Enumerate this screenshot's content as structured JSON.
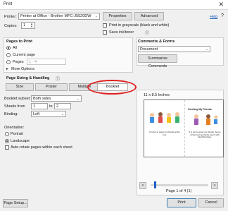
{
  "window": {
    "title": "Print"
  },
  "printer": {
    "label": "Printer:",
    "value": "Printer at Office - Brother MFC-J5520DW",
    "properties_label": "Properties",
    "advanced_label": "Advanced",
    "help_label": "Help"
  },
  "copies": {
    "label": "Copies:",
    "value": "1"
  },
  "options": {
    "grayscale_label": "Print in grayscale (black and white)",
    "save_ink_label": "Save ink/toner"
  },
  "pages": {
    "heading": "Pages to Print",
    "all_label": "All",
    "current_label": "Current page",
    "pages_label": "Pages",
    "pages_value": "1 - 4",
    "more_label": "More Options"
  },
  "sizing": {
    "heading": "Page Sizing & Handling",
    "tabs": [
      "Size",
      "Poster",
      "Multiple",
      "Booklet"
    ],
    "selected_tab": "Booklet",
    "subset_label": "Booklet subset:",
    "subset_value": "Both sides",
    "sheets_label": "Sheets from",
    "sheets_from": "1",
    "sheets_to_label": "to",
    "sheets_to": "2",
    "binding_label": "Binding:",
    "binding_value": "Left"
  },
  "orientation": {
    "heading": "Orientation:",
    "portrait_label": "Portrait",
    "landscape_label": "Landscape",
    "autorotate_label": "Auto-rotate pages within each sheet"
  },
  "comments": {
    "heading": "Comments & Forms",
    "value": "Document",
    "summarize_label": "Summarize Comments"
  },
  "preview": {
    "size_label": "11 x 8.5 Inches",
    "doc_title": "Greeting My Friends",
    "caption_left": "It is fun to greet my friends at the bus.",
    "caption_right": "It is fun to greet my friends. Some of the boys and girls say hi with hand that face.",
    "page_status": "Page 1 of 4 (1)"
  },
  "footer": {
    "page_setup_label": "Page Setup...",
    "print_label": "Print",
    "cancel_label": "Cancel"
  },
  "colors": {
    "annotation": "#e02020",
    "accent": "#1f5fc2"
  }
}
